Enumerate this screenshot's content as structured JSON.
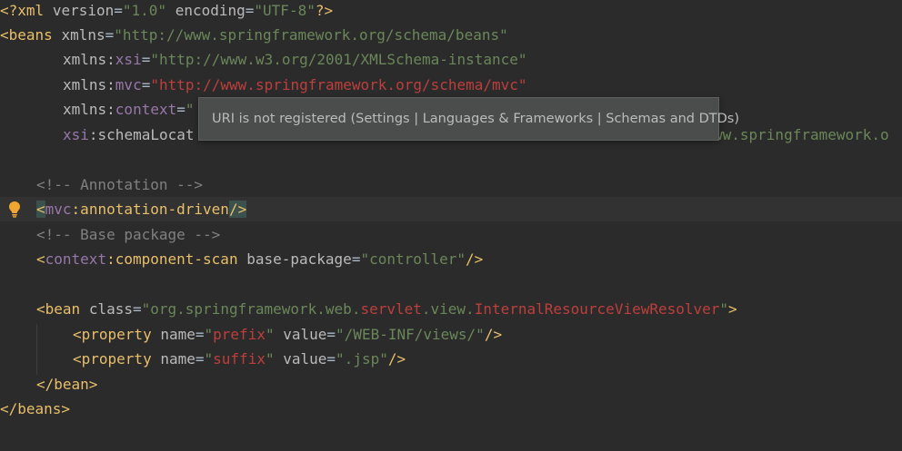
{
  "editor": {
    "tokens": {
      "xml_decl_open": "<?xml",
      "version_attr": "version",
      "version_val": "\"1.0\"",
      "encoding_attr": "encoding",
      "encoding_val": "\"UTF-8\"",
      "xml_decl_close": "?>",
      "beans_open": "<beans",
      "xmlns_attr": "xmlns",
      "beans_ns_val": "\"http://www.springframework.org/schema/beans\"",
      "xsi_prefix": "xmlns:",
      "xsi_name": "xsi",
      "xsi_val": "\"http://www.w3.org/2001/XMLSchema-instance\"",
      "mvc_name": "mvc",
      "mvc_val": "\"http://www.springframework.org/schema/mvc\"",
      "context_name": "context",
      "context_val_partial": "\"",
      "schemaloc_ns": "xsi",
      "schemaloc_attr": ":schemaLocat",
      "schemaloc_tail": "ww.springframework.o",
      "comment_annotation": "<!-- Annotation -->",
      "mvc_tag_open": "<",
      "mvc_tag_ns": "mvc",
      "mvc_tag_name": ":annotation-driven",
      "mvc_tag_close": "/>",
      "comment_base": "<!-- Base package -->",
      "ctx_tag_open": "<",
      "ctx_tag_ns": "context",
      "ctx_tag_name": ":component-scan",
      "basepkg_attr": "base-package",
      "basepkg_val": "\"controller\"",
      "self_close": "/>",
      "bean_open": "<bean",
      "class_attr": "class",
      "class_val_a": "\"org.springframework.web.",
      "class_val_b": "servlet",
      "class_val_c": ".view.",
      "class_val_d": "InternalResourceViewResolver",
      "class_val_e": "\"",
      "gt": ">",
      "property_open": "<property",
      "name_attr": "name",
      "prefix_val_q": "\"",
      "prefix_val": "prefix",
      "suffix_val": "suffix",
      "value_attr": "value",
      "prefix_value_val": "\"/WEB-INF/views/\"",
      "suffix_value_val": "\".jsp\"",
      "bean_close": "</bean>",
      "beans_close": "</beans>",
      "eq": "="
    }
  },
  "tooltip": {
    "text": "URI is not registered (Settings | Languages & Frameworks | Schemas and DTDs)"
  },
  "colors": {
    "background": "#2b2b2b",
    "tag": "#e8bf6a",
    "namespace": "#9876aa",
    "string": "#6a8759",
    "error_string": "#bc3f3c",
    "comment": "#808080",
    "attribute": "#bababa"
  },
  "icons": {
    "gutter": "lightbulb-icon"
  }
}
